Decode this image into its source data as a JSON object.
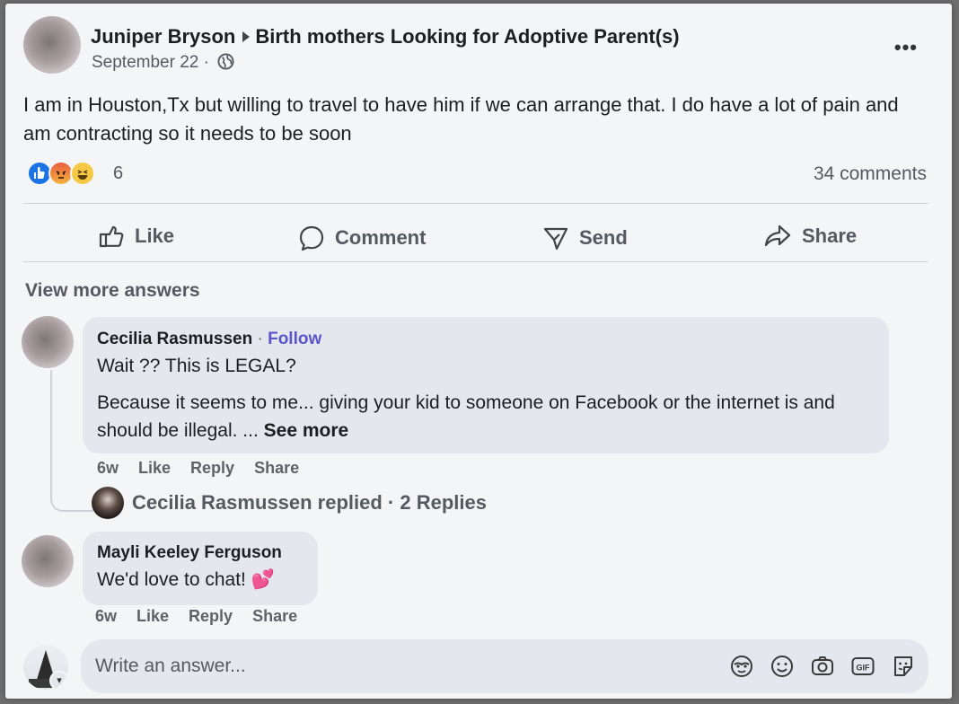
{
  "post": {
    "author": "Juniper Bryson",
    "group": "Birth mothers Looking for Adoptive Parent(s)",
    "date": "September 22 ·",
    "text": "I am in Houston,Tx but willing to travel to have him if we can arrange that. I do have a lot of pain and am contracting so it needs to be soon",
    "reaction_count": "6",
    "reaction_icons": [
      "like-icon",
      "angry-icon",
      "haha-icon"
    ],
    "comments_count": "34 comments"
  },
  "actions": {
    "like": "Like",
    "comment": "Comment",
    "send": "Send",
    "share": "Share"
  },
  "view_more": "View more answers",
  "comments": [
    {
      "author": "Cecilia Rasmussen",
      "follow": "Follow",
      "line1": "Wait ?? This is LEGAL?",
      "body": "Because it seems to me... giving your kid to someone on Facebook or the internet is and should be illegal. ...",
      "see_more": "See more",
      "time": "6w",
      "like": "Like",
      "reply": "Reply",
      "share": "Share",
      "replied_text": "Cecilia Rasmussen replied · 2 Replies"
    },
    {
      "author": "Mayli Keeley Ferguson",
      "text": "We'd love to chat!",
      "emoji": "💕",
      "time": "6w",
      "like": "Like",
      "reply": "Reply",
      "share": "Share"
    }
  ],
  "composer": {
    "placeholder": "Write an answer...",
    "gif_label": "GIF"
  },
  "colors": {
    "like_blue": "#1b74e4",
    "follow": "#5a55c8",
    "bubble": "#e4e8ee"
  }
}
